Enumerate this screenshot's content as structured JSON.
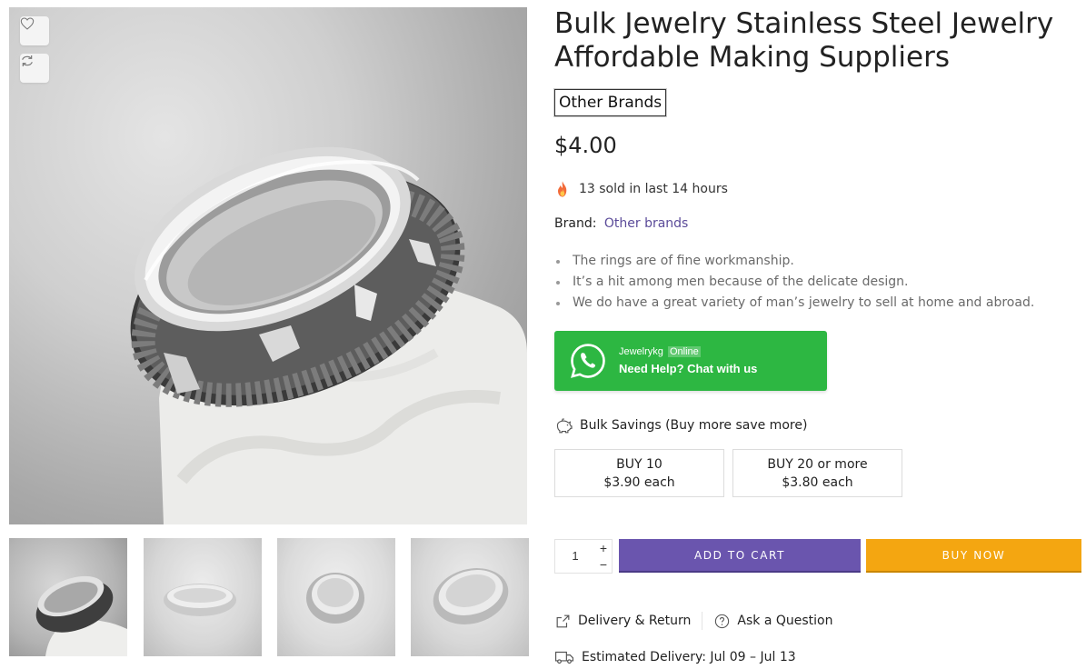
{
  "product": {
    "title": "Bulk Jewelry Stainless Steel Jewelry Affordable Making Suppliers",
    "brand_badge": "Other Brands",
    "price": "$4.00",
    "sold_text": "13 sold in last 14 hours",
    "brand_label": "Brand:",
    "brand_value": "Other brands",
    "features": [
      "The rings are of fine workmanship.",
      "It’s a hit among men because of the delicate design.",
      "We do have a great variety of man’s jewelry to sell at home and abroad."
    ]
  },
  "gallery": {
    "main_icon": "ring-photo",
    "actions": {
      "wishlist_icon": "heart-icon",
      "compare_icon": "refresh-icon"
    },
    "thumbnails": [
      "ring-photo-1",
      "ring-photo-2",
      "ring-photo-3",
      "ring-photo-4"
    ]
  },
  "whatsapp": {
    "name": "Jewelrykg",
    "status": "Online",
    "help_text": "Need Help? Chat with us",
    "color": "#2db742"
  },
  "bulk": {
    "title": "Bulk Savings (Buy more save more)",
    "tiers": [
      {
        "qty": "BUY 10",
        "price": "$3.90 each"
      },
      {
        "qty": "BUY 20 or more",
        "price": "$3.80 each"
      }
    ]
  },
  "cart": {
    "quantity": "1",
    "plus": "+",
    "minus": "−",
    "add_to_cart": "ADD TO CART",
    "buy_now": "BUY NOW",
    "add_color": "#6a55ae",
    "buy_color": "#f4a611"
  },
  "links": {
    "delivery_return": "Delivery & Return",
    "ask_question": "Ask a Question"
  },
  "delivery": {
    "text": "Estimated Delivery: Jul 09 – Jul 13"
  }
}
